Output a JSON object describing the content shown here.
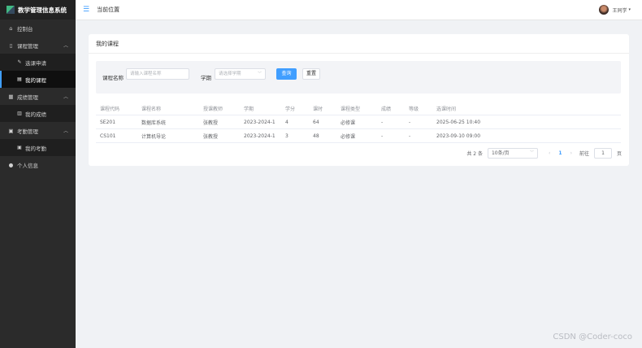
{
  "app_title": "教学管理信息系统",
  "sidebar": {
    "items": [
      {
        "label": "控制台",
        "icon": "home-icon"
      },
      {
        "label": "课程管理",
        "icon": "book-icon",
        "expanded": true,
        "children": [
          {
            "label": "选课申请",
            "icon": "edit-icon"
          },
          {
            "label": "我的课程",
            "icon": "notebook-icon",
            "active": true
          }
        ]
      },
      {
        "label": "成绩管理",
        "icon": "chart-icon",
        "expanded": true,
        "children": [
          {
            "label": "我的成绩",
            "icon": "document-icon"
          }
        ]
      },
      {
        "label": "考勤管理",
        "icon": "calendar-icon",
        "expanded": true,
        "children": [
          {
            "label": "我的考勤",
            "icon": "calendar-icon"
          }
        ]
      },
      {
        "label": "个人信息",
        "icon": "user-icon"
      }
    ]
  },
  "header": {
    "breadcrumb": "当前位置",
    "user_name": "王同学"
  },
  "card": {
    "title": "我的课程"
  },
  "search": {
    "course_name_label": "课程名称",
    "course_name_placeholder": "请输入课程名称",
    "semester_label": "学期",
    "semester_placeholder": "请选择学期",
    "search_button": "查询",
    "reset_button": "重置"
  },
  "table": {
    "columns": [
      "课程代码",
      "课程名称",
      "授课教师",
      "学期",
      "学分",
      "课时",
      "课程类型",
      "成绩",
      "等级",
      "选课时间"
    ],
    "rows": [
      [
        "SE201",
        "数据库系统",
        "张教授",
        "2023-2024-1",
        "4",
        "64",
        "必修课",
        "-",
        "-",
        "2025-06-25 10:40"
      ],
      [
        "CS101",
        "计算机导论",
        "张教授",
        "2023-2024-1",
        "3",
        "48",
        "必修课",
        "-",
        "-",
        "2023-09-10 09:00"
      ]
    ]
  },
  "pagination": {
    "total_text": "共 2 条",
    "page_size": "10条/页",
    "current_page": "1",
    "goto_label": "前往",
    "goto_value": "1",
    "page_suffix": "页"
  },
  "watermark": "CSDN @Coder-coco",
  "colors": {
    "accent": "#409eff",
    "sidebar_bg": "#2b2b2b"
  }
}
